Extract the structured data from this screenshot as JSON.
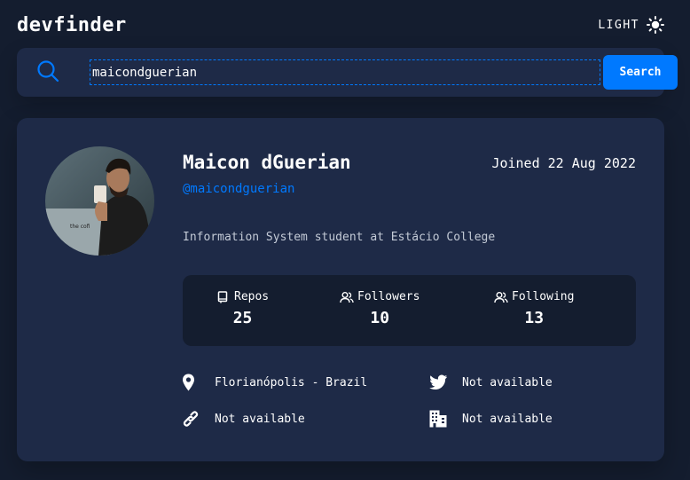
{
  "header": {
    "logo": "devfinder",
    "theme_label": "LIGHT",
    "theme_icon": "sun-icon"
  },
  "search": {
    "value": "maicondguerian",
    "placeholder": "",
    "button_label": "Search",
    "icon": "search-icon"
  },
  "profile": {
    "name": "Maicon dGuerian",
    "login": "@maicondguerian",
    "joined": "Joined 22 Aug 2022",
    "bio": "Information System student at Estácio College",
    "avatar_text": "the cofi"
  },
  "stats": {
    "repos": {
      "label": "Repos",
      "value": "25",
      "icon": "book-icon"
    },
    "followers": {
      "label": "Followers",
      "value": "10",
      "icon": "users-icon"
    },
    "following": {
      "label": "Following",
      "value": "13",
      "icon": "users-icon"
    }
  },
  "info": {
    "location": {
      "text": "Florianópolis - Brazil",
      "icon": "location-pin-icon"
    },
    "twitter": {
      "text": "Not available",
      "icon": "twitter-icon"
    },
    "website": {
      "text": "Not available",
      "icon": "link-icon"
    },
    "company": {
      "text": "Not available",
      "icon": "building-icon"
    }
  },
  "colors": {
    "background": "#141d2f",
    "card": "#1e2a47",
    "accent": "#0079ff",
    "text": "#ffffff",
    "muted": "#c3cad6"
  }
}
